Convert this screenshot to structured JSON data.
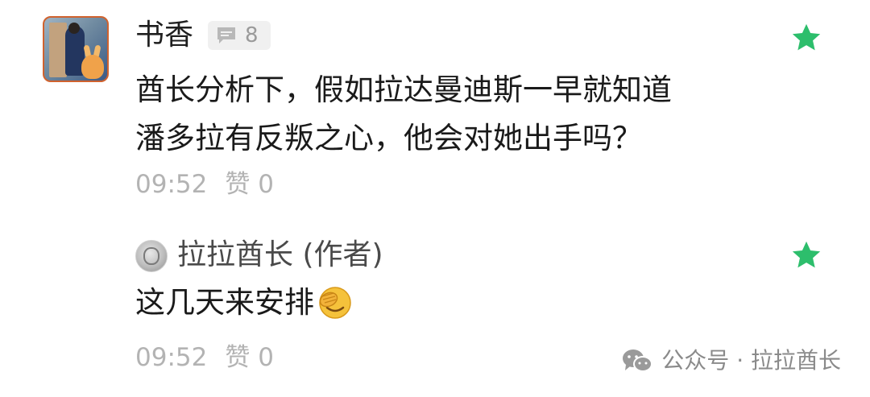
{
  "comments": [
    {
      "author": "书香",
      "reply_count": "8",
      "content": "酋长分析下，假如拉达曼迪斯一早就知道\n潘多拉有反叛之心，他会对她出手吗？",
      "time": "09:52",
      "likes": "赞 0",
      "starred": true
    },
    {
      "author": "拉拉酋长 (作者)",
      "content": "这几天来安排",
      "emoji": "facepalm-emoji",
      "time": "09:52",
      "likes": "赞 0",
      "starred": true
    }
  ],
  "icons": {
    "comment_badge": "comment-icon",
    "star": "star-icon",
    "watermark": "wechat-icon"
  },
  "colors": {
    "star": "#2dbe6c",
    "meta_text": "#b3b3b3",
    "avatar_border": "#d0622e"
  },
  "watermark": {
    "text": "公众号 · 拉拉酋长"
  }
}
